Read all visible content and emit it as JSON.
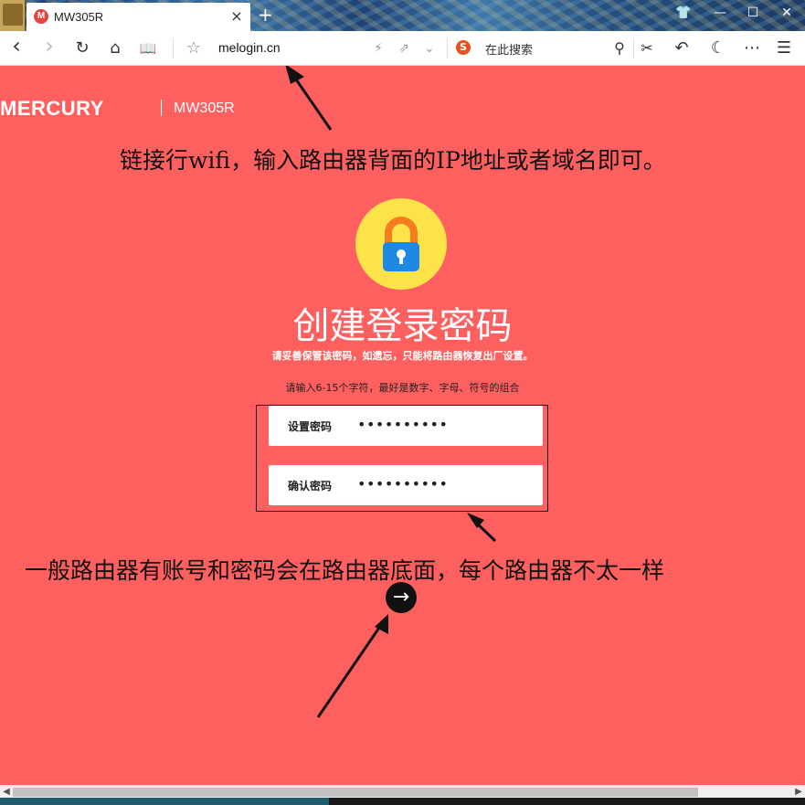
{
  "tab": {
    "favicon_letter": "M",
    "title": "MW305R",
    "close": "×",
    "new_tab": "+"
  },
  "window": {
    "shirt": "👕",
    "minimize": "—",
    "maximize": "☐",
    "close": "✕"
  },
  "toolbar": {
    "url": "melogin.cn",
    "search_engine": "S",
    "search_placeholder": "在此搜索",
    "icons": {
      "back": "‹",
      "forward": "›",
      "reload": "↻",
      "home": "⌂",
      "reader": "📖",
      "bookmark": "☆",
      "flash": "⚡",
      "share": "⇗",
      "chevron": "⌄",
      "search": "⚲",
      "cut": "✂",
      "undo": "↶",
      "night": "☾",
      "more": "⋯",
      "menu": "☰"
    }
  },
  "page": {
    "brand": "MERCURY",
    "model": "MW305R",
    "note_top": "链接行wifi，输入路由器背面的IP地址或者域名即可。",
    "heading": "创建登录密码",
    "subheading": "请妥善保管该密码，如遗忘，只能将路由器恢复出厂设置。",
    "hint": "请输入6-15个字符，最好是数字、字母、符号的组合",
    "fields": [
      {
        "label": "设置密码",
        "value": "••••••••••"
      },
      {
        "label": "确认密码",
        "value": "••••••••••"
      }
    ],
    "note_bottom": "一般路由器有账号和密码会在路由器底面，每个路由器不太一样",
    "next": "→"
  },
  "colors": {
    "page_bg": "#fe6060",
    "lock_circle": "#fde34a",
    "lock_body": "#1e88e5",
    "lock_shackle": "#f57c1f"
  }
}
